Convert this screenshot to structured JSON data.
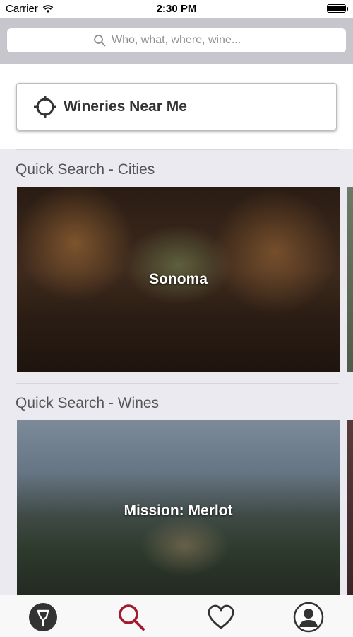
{
  "status_bar": {
    "carrier": "Carrier",
    "time": "2:30 PM"
  },
  "search": {
    "placeholder": "Who, what, where, wine..."
  },
  "near_me": {
    "label": "Wineries Near Me",
    "icon": "crosshair-icon"
  },
  "sections": {
    "cities": {
      "title": "Quick Search - Cities",
      "cards": [
        {
          "label": "Sonoma"
        }
      ]
    },
    "wines": {
      "title": "Quick Search - Wines",
      "cards": [
        {
          "label": "Mission: Merlot"
        }
      ]
    }
  },
  "tab_bar": {
    "active": "search",
    "accent_color": "#a31a2f",
    "items": [
      {
        "id": "home",
        "icon": "winery-logo-icon"
      },
      {
        "id": "search",
        "icon": "search-icon"
      },
      {
        "id": "favorites",
        "icon": "heart-icon"
      },
      {
        "id": "profile",
        "icon": "profile-icon"
      }
    ]
  }
}
